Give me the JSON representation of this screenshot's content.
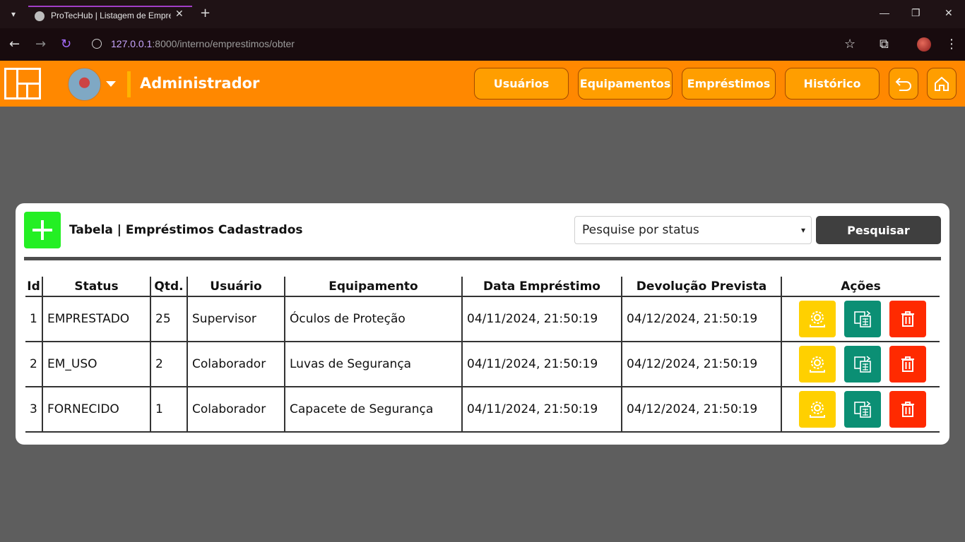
{
  "browser": {
    "tab_title": "ProTecHub | Listagem de Empre",
    "url_host": "127.0.0.1",
    "url_rest": ":8000/interno/emprestimos/obter"
  },
  "header": {
    "role": "Administrador",
    "nav": [
      "Usuários",
      "Equipamentos",
      "Empréstimos",
      "Histórico"
    ],
    "accent": "#ff8800"
  },
  "card": {
    "title": "Tabela | Empréstimos Cadastrados",
    "select_value": "Pesquise por status",
    "search_label": "Pesquisar"
  },
  "table": {
    "headers": [
      "Id",
      "Status",
      "Qtd.",
      "Usuário",
      "Equipamento",
      "Data Empréstimo",
      "Devolução Prevista",
      "Ações"
    ],
    "rows": [
      [
        "1",
        "EMPRESTADO",
        "25",
        "Supervisor",
        "Óculos de Proteção",
        "04/11/2024, 21:50:19",
        "04/12/2024, 21:50:19"
      ],
      [
        "2",
        "EM_USO",
        "2",
        "Colaborador",
        "Luvas de Segurança",
        "04/11/2024, 21:50:19",
        "04/12/2024, 21:50:19"
      ],
      [
        "3",
        "FORNECIDO",
        "1",
        "Colaborador",
        "Capacete de Segurança",
        "04/11/2024, 21:50:19",
        "04/12/2024, 21:50:19"
      ]
    ]
  }
}
